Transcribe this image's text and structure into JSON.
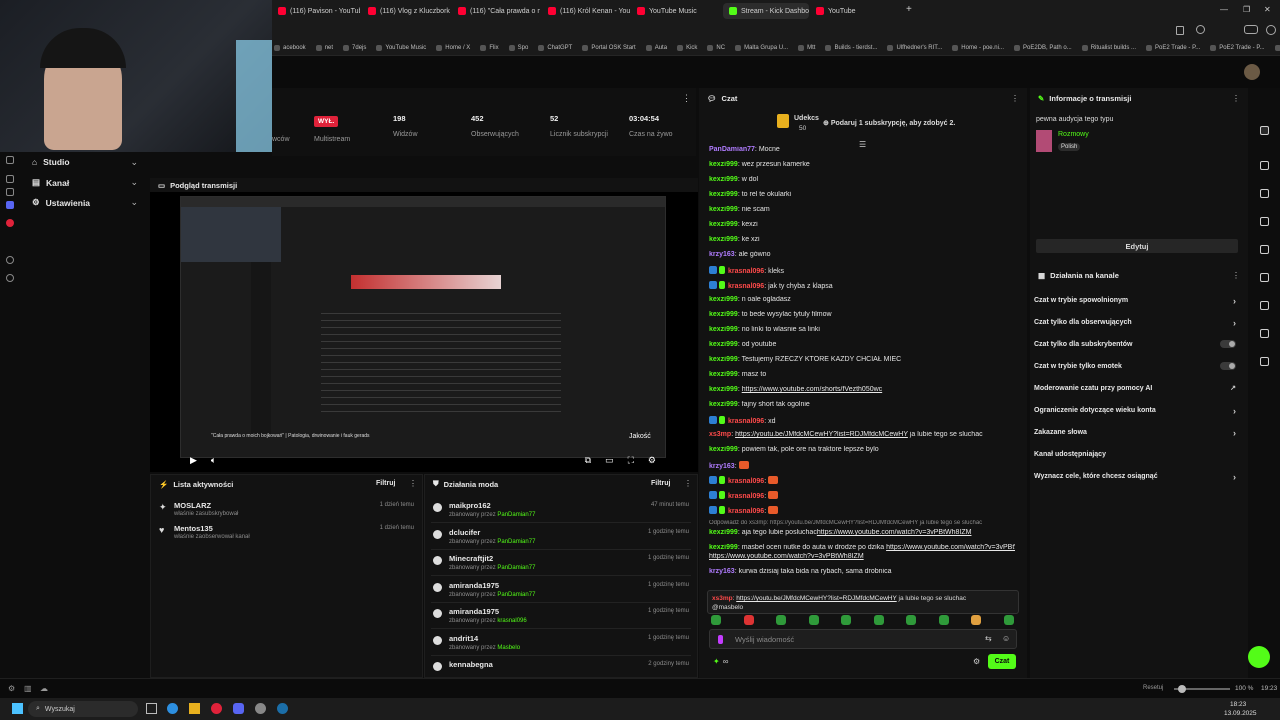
{
  "browser": {
    "tabs": [
      {
        "label": "(116) Pavison - YouTube",
        "color": "#ff0033",
        "active": false
      },
      {
        "label": "(116) Vlog z Kluczborka Ni",
        "color": "#ff0033",
        "active": false
      },
      {
        "label": "(116) \"Cała prawda o moic",
        "color": "#ff0033",
        "active": false
      },
      {
        "label": "(116) Król Kenan - YouTub",
        "color": "#ff0033",
        "active": false
      },
      {
        "label": "YouTube Music",
        "color": "#ff0033",
        "active": false
      },
      {
        "label": "Stream - Kick Dashboard",
        "color": "#53fc18",
        "active": true
      },
      {
        "label": "YouTube",
        "color": "#ff0033",
        "active": false
      }
    ],
    "bookmarks": [
      "acebook",
      "net",
      "7dejs",
      "YouTube Music",
      "Home / X",
      "Flix",
      "Spo",
      "ChatGPT",
      "Portal OSK Start",
      "Auta",
      "Kick",
      "NC",
      "Malta Grupa U...",
      "Mtt",
      "Builds - tierdst...",
      "Ulfhedner's RIT...",
      "Home - poe.ni...",
      "PoE2DB, Path o...",
      "Ritualist builds ...",
      "PoE2 Trade - P...",
      "PoE2 Trade - P...",
      "PoE2 Trade - P..."
    ]
  },
  "nav": {
    "items": [
      {
        "label": "Studio",
        "icon": "studio-icon"
      },
      {
        "label": "Kanał",
        "icon": "channel-icon"
      },
      {
        "label": "Ustawienia",
        "icon": "gear-icon"
      }
    ]
  },
  "stats": {
    "partial_label": "wców",
    "multistream_badge": "WYŁ.",
    "multistream_label": "Multistream",
    "items": [
      {
        "value": "198",
        "label": "Widzów"
      },
      {
        "value": "452",
        "label": "Obserwujących"
      },
      {
        "value": "52",
        "label": "Licznik subskrypcji"
      },
      {
        "value": "03:04:54",
        "label": "Czas na żywo"
      }
    ]
  },
  "preview": {
    "title": "Podgląd transmisji",
    "quality": "Jakość",
    "caption": "\"Cała prawda o moich bojkowań\" | Patologia, drwinowanie i fauk gerads"
  },
  "activity": {
    "title": "Lista aktywności",
    "filter": "Filtruj",
    "items": [
      {
        "name": "MOSLARZ",
        "action": "właśnie zasubskrybował",
        "time": "1 dzień temu"
      },
      {
        "name": "Mentos135",
        "action": "właśnie zaobserwował kanał",
        "time": "1 dzień temu"
      }
    ]
  },
  "mod": {
    "title": "Działania moda",
    "filter": "Filtruj",
    "prefix": "zbanowany przez",
    "items": [
      {
        "name": "maikpro162",
        "by": "PanDamian77",
        "time": "47 minut temu"
      },
      {
        "name": "dclucifer",
        "by": "PanDamian77",
        "time": "1 godzinę temu"
      },
      {
        "name": "Minecraftjit2",
        "by": "PanDamian77",
        "time": "1 godzinę temu"
      },
      {
        "name": "amiranda1975",
        "by": "PanDamian77",
        "time": "1 godzinę temu"
      },
      {
        "name": "amiranda1975",
        "by": "krasnal096",
        "time": "1 godzinę temu"
      },
      {
        "name": "andrit14",
        "by": "Masbelo",
        "time": "1 godzinę temu"
      },
      {
        "name": "kennabegna",
        "by": "",
        "time": "2 godziny temu"
      }
    ]
  },
  "chat": {
    "title": "Czat",
    "gift_user": "Udekcs",
    "gift_amount": "50",
    "gift_text": "Podaruj 1 subskrypcję, aby zdobyć 2.",
    "messages": [
      {
        "user": "PanDamian77",
        "color": "#b07cff",
        "text": "Mocne",
        "badge": false
      },
      {
        "user": "kexzi999",
        "color": "#53fc18",
        "text": "wez przesun kamerke",
        "badge": false
      },
      {
        "user": "kexzi999",
        "color": "#53fc18",
        "text": "w dol",
        "badge": false
      },
      {
        "user": "kexzi999",
        "color": "#53fc18",
        "text": "to rel te okularki",
        "badge": false
      },
      {
        "user": "kexzi999",
        "color": "#53fc18",
        "text": "nie scam",
        "badge": false
      },
      {
        "user": "kexzi999",
        "color": "#53fc18",
        "text": "kexzi",
        "badge": false
      },
      {
        "user": "kexzi999",
        "color": "#53fc18",
        "text": "ke xzi",
        "badge": false
      },
      {
        "user": "krzy163",
        "color": "#b07cff",
        "text": "ale gówno",
        "badge": false
      },
      {
        "user": "krasnal096",
        "color": "#ff4a4a",
        "text": "kleks",
        "badge": true
      },
      {
        "user": "krasnal096",
        "color": "#ff4a4a",
        "text": "jak ty chyba z klapsa",
        "badge": true
      },
      {
        "user": "kexzi999",
        "color": "#53fc18",
        "text": "n oale ogladasz",
        "badge": false
      },
      {
        "user": "kexzi999",
        "color": "#53fc18",
        "text": "to bede wysylac tytuly filmow",
        "badge": false
      },
      {
        "user": "kexzi999",
        "color": "#53fc18",
        "text": "no linki to wlasnie sa linki",
        "badge": false
      },
      {
        "user": "kexzi999",
        "color": "#53fc18",
        "text": "od youtube",
        "badge": false
      },
      {
        "user": "kexzi999",
        "color": "#53fc18",
        "text": "Testujemy RZECZY KTÓRE KAŻDY CHCIAŁ MIEĆ",
        "badge": false
      },
      {
        "user": "kexzi999",
        "color": "#53fc18",
        "text": "masz to",
        "badge": false
      },
      {
        "user": "kexzi999",
        "color": "#53fc18",
        "text": "",
        "link": "https://www.youtube.com/shorts/fVezth050wc",
        "badge": false
      },
      {
        "user": "kexzi999",
        "color": "#53fc18",
        "text": "fajny short tak ogolnie",
        "badge": false
      },
      {
        "user": "krasnal096",
        "color": "#ff4a4a",
        "text": "xd",
        "badge": true
      },
      {
        "user": "xs3mp",
        "color": "#ff4a4a",
        "link": "https://youtu.be/JMfdcMCewHY?list=RDJMfdcMCewHY",
        "text": " ja lubie tego se sluchac",
        "badge": false
      },
      {
        "user": "kexzi999",
        "color": "#53fc18",
        "text": "powiem tak, pole ore na traktore lepsze bylo",
        "badge": false
      },
      {
        "user": "krzy163",
        "color": "#b07cff",
        "text": "",
        "badge": false
      },
      {
        "user": "krasnal096",
        "color": "#ff4a4a",
        "text": "",
        "badge": true
      },
      {
        "user": "krasnal096",
        "color": "#ff4a4a",
        "text": "",
        "badge": true
      },
      {
        "user": "krasnal096",
        "color": "#ff4a4a",
        "text": "",
        "badge": true
      }
    ],
    "reply_line": "Odpowiadź do xs3mp: https://youtu.be/JMfdcMCewHY?list=RDJMfdcMCewHY ja lubie tego se sluchac",
    "messages2": [
      {
        "user": "kexzi999",
        "color": "#53fc18",
        "link": "https://www.youtube.com/watch?v=3vPBtWh8IZM",
        "text": " aja tego lubie posluchac"
      },
      {
        "user": "kexzi999",
        "color": "#53fc18",
        "text": "masbel ocen nutke do auta w drodze po dzika ",
        "link": "https://www.youtube.com/watch?v=3vPBtWh8IZM"
      },
      {
        "user": "krzy163",
        "color": "#b07cff",
        "text": "kurwa dzisiaj taka bida na rybach, sama drobnica"
      }
    ],
    "pinned_user": "xs3mp",
    "pinned_link": "https://youtu.be/JMfdcMCewHY?list=RDJMfdcMCewHY",
    "pinned_text": " ja lubie tego se sluchac",
    "pinned_mention": "@masbelo",
    "input_placeholder": "Wyślij wiadomość",
    "send_label": "Czat",
    "footer_count": "∞"
  },
  "info": {
    "title": "Informacje o transmisji",
    "audience": "pewna audycja tego typu",
    "category": "Rozmowy",
    "language": "Polish",
    "edit_label": "Edytuj"
  },
  "channel_actions": {
    "title": "Działania na kanale",
    "items": [
      {
        "label": "Czat w trybie spowolnionym",
        "kind": "chevron"
      },
      {
        "label": "Czat tylko dla obserwujących",
        "kind": "chevron"
      },
      {
        "label": "Czat tylko dla subskrybentów",
        "kind": "toggle"
      },
      {
        "label": "Czat w trybie tylko emotek",
        "kind": "toggle"
      },
      {
        "label": "Moderowanie czatu przy pomocy AI",
        "kind": "external"
      },
      {
        "label": "Ograniczenie dotyczące wieku konta",
        "kind": "chevron"
      },
      {
        "label": "Zakazane słowa",
        "kind": "chevron"
      },
      {
        "label": "Kanał udostępniający",
        "kind": "none"
      },
      {
        "label": "Wyznacz cele, które chcesz osiągnąć",
        "kind": "chevron"
      }
    ]
  },
  "statusbar": {
    "zoom_label": "Resetuj",
    "zoom": "100 %",
    "time": "19:23"
  },
  "taskbar": {
    "search": "Wyszukaj",
    "time": "18:23",
    "date": "13.09.2025"
  }
}
